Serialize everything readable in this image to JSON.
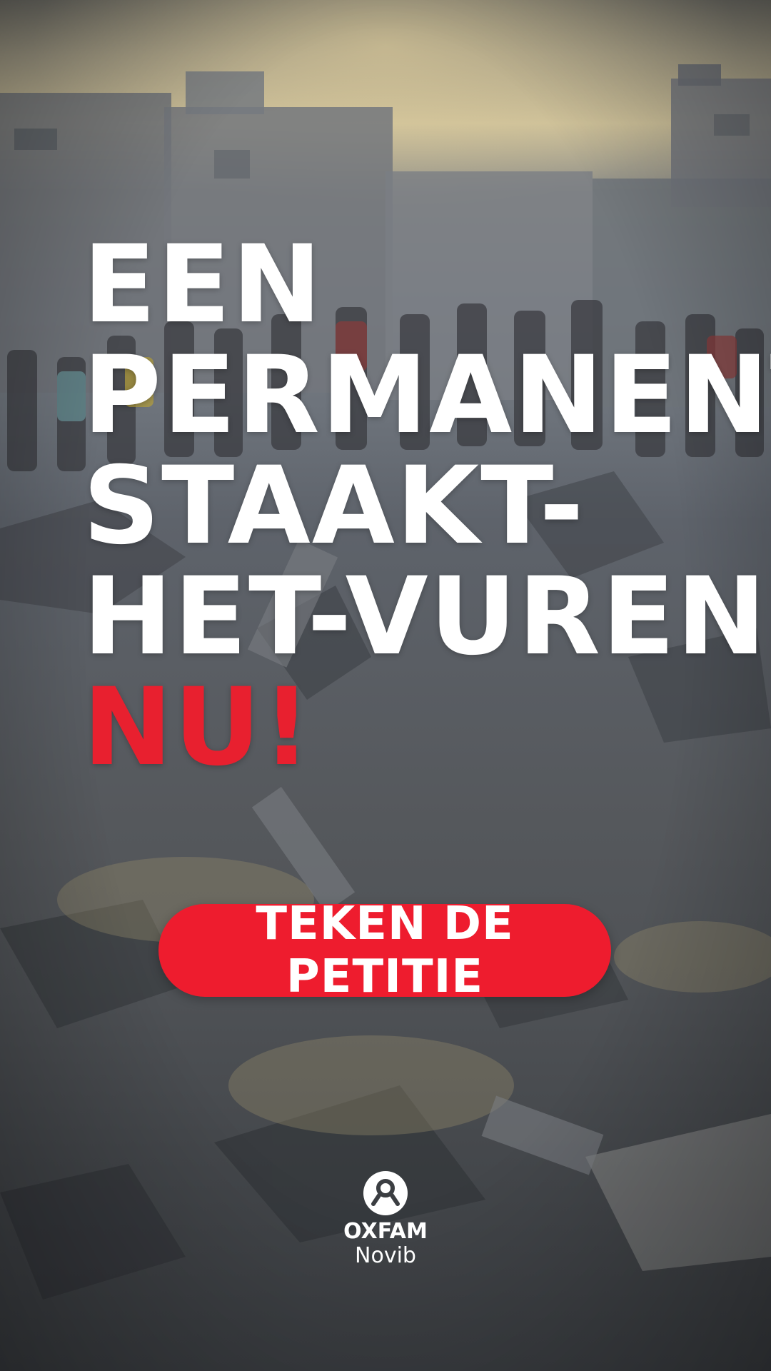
{
  "headline": {
    "lines": [
      "EEN",
      "PERMANENT",
      "STAAKT-",
      "HET-VUREN"
    ],
    "accent_line": "NU!"
  },
  "cta": {
    "label": "TEKEN DE PETITIE"
  },
  "logo": {
    "brand": "OXFAM",
    "sub": "Novib",
    "icon": "oxfam-logo-icon"
  },
  "colors": {
    "accent": "#ee1c2e",
    "headline": "#ffffff"
  }
}
